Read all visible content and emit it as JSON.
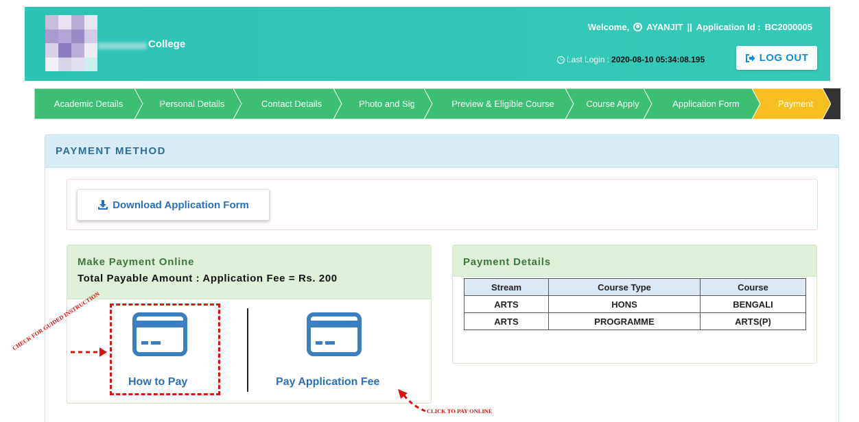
{
  "header": {
    "college_name": "College",
    "welcome_label": "Welcome,",
    "user_name": "AYANJIT",
    "separator": "||",
    "app_id_label": "Application Id :",
    "app_id": "BC2000005",
    "last_login_label": "Last Login :",
    "last_login_value": "2020-08-10 05:34:08.195",
    "logout_label": "LOG OUT"
  },
  "steps": [
    {
      "label": "Academic Details",
      "state": "done"
    },
    {
      "label": "Personal Details",
      "state": "done"
    },
    {
      "label": "Contact Details",
      "state": "done"
    },
    {
      "label": "Photo and Sig",
      "state": "done"
    },
    {
      "label": "Preview & Eligible Course",
      "state": "done"
    },
    {
      "label": "Course Apply",
      "state": "done"
    },
    {
      "label": "Application Form",
      "state": "done"
    },
    {
      "label": "Payment",
      "state": "active"
    }
  ],
  "payment": {
    "title": "PAYMENT METHOD",
    "download_label": "Download Application Form",
    "online": {
      "title": "Make Payment Online",
      "total": "Total Payable Amount : Application Fee = Rs. 200",
      "how_to_pay": "How to Pay",
      "pay_fee": "Pay Application Fee"
    },
    "details": {
      "title": "Payment Details",
      "columns": [
        "Stream",
        "Course Type",
        "Course"
      ],
      "rows": [
        [
          "ARTS",
          "HONS",
          "BENGALI"
        ],
        [
          "ARTS",
          "PROGRAMME",
          "ARTS(P)"
        ]
      ]
    }
  },
  "annotations": {
    "left": "CHECK FOR GUIDED INSTRUCTION",
    "right": "CLICK TO PAY ONLINE"
  },
  "colors": {
    "header": "#2ec4b6",
    "step_done": "#3dbf73",
    "step_active": "#f7bf1e",
    "accent_blue": "#2a70b8",
    "annotation_red": "#e01010"
  },
  "icons": {
    "user": "user-circle-icon",
    "clock": "clock-icon",
    "logout": "sign-out-icon",
    "download": "download-icon",
    "card": "credit-card-icon"
  }
}
